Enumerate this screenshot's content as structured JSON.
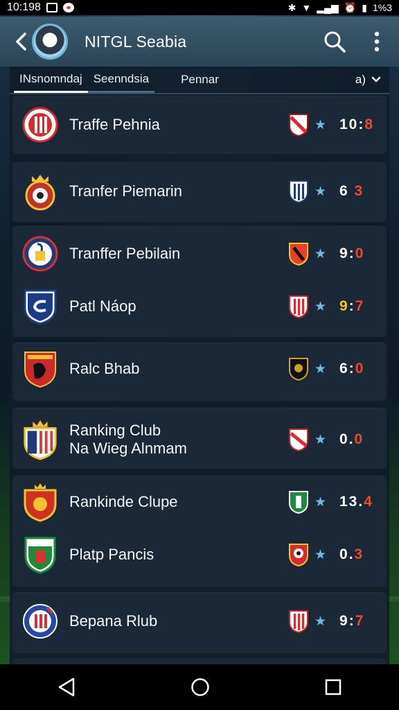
{
  "status_bar": {
    "time": "10:198",
    "right_text": "1%3"
  },
  "app_bar": {
    "title": "NITGL Seabia"
  },
  "tabs": [
    {
      "label": "INsnomndaj"
    },
    {
      "label": "Seenndsia"
    },
    {
      "label": "Pennar"
    }
  ],
  "dropdown": {
    "label": "a)"
  },
  "rows": [
    {
      "name_line1": "Traffe Pehnia",
      "name_line2": "",
      "score_home": "10",
      "score_sep": ":",
      "score_away": "8",
      "crest_colors": [
        "#d92b2b",
        "#ffffff"
      ]
    },
    {
      "name_line1": "Tranfer Piemarin",
      "name_line2": "",
      "score_home": "6",
      "score_sep": " ",
      "score_away": "3",
      "crest_colors": [
        "#c43126",
        "#f1c232"
      ]
    },
    {
      "name_line1": "Tranffer Pebilain",
      "name_line2": "",
      "score_home": "9",
      "score_sep": ":",
      "score_away": "0",
      "crest_colors": [
        "#1f3b7a",
        "#ffffff"
      ]
    },
    {
      "name_line1": "Patl Náop",
      "name_line2": "",
      "score_home": "9",
      "score_sep": ":",
      "score_away": "7",
      "crest_colors": [
        "#1b3a8a",
        "#ffffff"
      ]
    },
    {
      "name_line1": "Ralc Bhab",
      "name_line2": "",
      "score_home": "6",
      "score_sep": ":",
      "score_away": "0",
      "crest_colors": [
        "#cc2a2a",
        "#111111"
      ]
    },
    {
      "name_line1": "Ranking Club",
      "name_line2": "Na Wieg Alnmam",
      "score_home": "0",
      "score_sep": ".",
      "score_away": "0",
      "crest_colors": [
        "#d43c3c",
        "#ffffff"
      ]
    },
    {
      "name_line1": "Rankinde Clupe",
      "name_line2": "",
      "score_home": "13",
      "score_sep": ".",
      "score_away": "4",
      "crest_colors": [
        "#d0301f",
        "#f1c232"
      ]
    },
    {
      "name_line1": "Platp Pancis",
      "name_line2": "",
      "score_home": "0",
      "score_sep": ".",
      "score_away": "3",
      "crest_colors": [
        "#1e8a3a",
        "#ffffff"
      ]
    },
    {
      "name_line1": "Bepana Rlub",
      "name_line2": "",
      "score_home": "9",
      "score_sep": ":",
      "score_away": "7",
      "crest_colors": [
        "#2448a8",
        "#d93030"
      ]
    }
  ],
  "colors": {
    "accent_blue": "#6fb8e6",
    "score_red": "#e84a2c",
    "score_gold": "#f2c622",
    "app_bar": "#3d5b6e"
  }
}
